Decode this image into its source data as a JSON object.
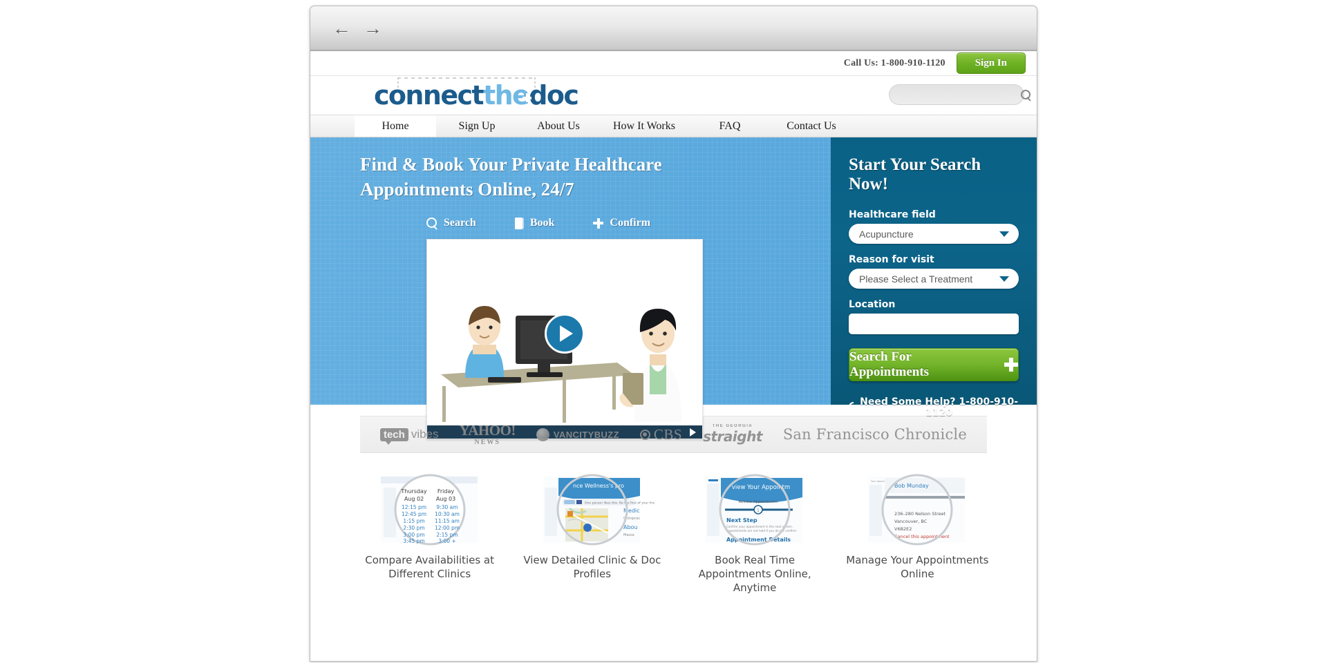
{
  "browser": {
    "back_icon": "←",
    "forward_icon": "→"
  },
  "topbar": {
    "call_us": "Call Us: 1-800-910-1120",
    "sign_in": "Sign In"
  },
  "logo": {
    "part1": "connect",
    "part2": "the",
    "part3": "d",
    "part4": "c"
  },
  "header_search": {
    "placeholder": "",
    "value": "",
    "icon": "search-icon"
  },
  "nav": {
    "items": [
      {
        "label": "Home",
        "active": true
      },
      {
        "label": "Sign Up",
        "active": false
      },
      {
        "label": "About Us",
        "active": false
      },
      {
        "label": "How It Works",
        "active": false
      },
      {
        "label": "FAQ",
        "active": false
      },
      {
        "label": "Contact Us",
        "active": false
      }
    ]
  },
  "hero": {
    "headline_line1": "Find & Book Your Private Healthcare",
    "headline_line2": "Appointments Online, 24/7",
    "steps": [
      {
        "label": "Search",
        "icon": "search-icon"
      },
      {
        "label": "Book",
        "icon": "book-icon"
      },
      {
        "label": "Confirm",
        "icon": "plus-icon"
      }
    ],
    "video": {
      "play_icon": "play-button",
      "control_play_icon": "play-arrow-icon"
    }
  },
  "panel": {
    "title": "Start Your Search Now!",
    "field_label": "Healthcare field",
    "field_value": "Acupuncture",
    "reason_label": "Reason for visit",
    "reason_value": "Please Select a Treatment",
    "location_label": "Location",
    "location_value": "",
    "location_placeholder": "",
    "search_button": "Search For Appointments",
    "help_text": "Need Some Help? 1-800-910-1120"
  },
  "press": {
    "logos": [
      {
        "name": "techvibes",
        "box": "tech",
        "rest": "vibes"
      },
      {
        "name": "yahoo-news",
        "big": "YAHOO!",
        "small": "NEWS"
      },
      {
        "name": "vancitybuzz",
        "text": "VANCITYBUZZ"
      },
      {
        "name": "cbs",
        "text": "CBS"
      },
      {
        "name": "georgia-straight",
        "top": "THE GEORGIA",
        "bottom": "straight"
      },
      {
        "name": "san-francisco-chronicle",
        "text": "San Francisco Chronicle"
      }
    ]
  },
  "features": [
    {
      "caption": "Compare Availabilities at Different Clinics",
      "thumb": {
        "col1_day": "Thursday",
        "col1_date": "Aug 02",
        "col2_day": "Friday",
        "col2_date": "Aug 03",
        "col1_times": [
          "12:15 pm",
          "12:45 pm",
          "1:15 pm",
          "2:30 pm",
          "3:00 pm",
          "3:45 pm"
        ],
        "col2_times": [
          "9:30 am",
          "10:30 am",
          "11:15 am",
          "12:00 pm",
          "2:15 pm",
          "3:00 +"
        ]
      }
    },
    {
      "caption": "View Detailed Clinic & Doc Profiles",
      "thumb": {
        "header": "nce Wellness's pro",
        "like": "Like",
        "fb_text": "One person likes this. Be the first of your frie",
        "right1": "Medic",
        "right2": "Chiroprac",
        "right3": "Abou",
        "right4": "Massa"
      }
    },
    {
      "caption": "Book Real Time Appointments Online, Anytime",
      "thumb": {
        "header": "view Your Appointm",
        "step": "Review Appointment",
        "step_num": "1",
        "next_step": "Next Step",
        "next_body1": "Confirm your appointment in the next screen.",
        "next_body2": "Appointments are not held if you do not confirm.",
        "details": "Appointment Details"
      }
    },
    {
      "caption": "Manage Your Appointments Online",
      "thumb": {
        "name": "Bob Munday",
        "addr1": "236–280 Nelson Street",
        "addr2": "Vancouver, BC",
        "addr3": "V6B2E2",
        "cancel": "Cancel this appointment"
      }
    }
  ],
  "colors": {
    "brand_dark_blue": "#1c5c8c",
    "brand_light_blue": "#6fb8e4",
    "panel_blue": "#0c6489",
    "hero_blue": "#5aa9de",
    "green": "#74b52b",
    "cancel_red": "#c0392b"
  }
}
